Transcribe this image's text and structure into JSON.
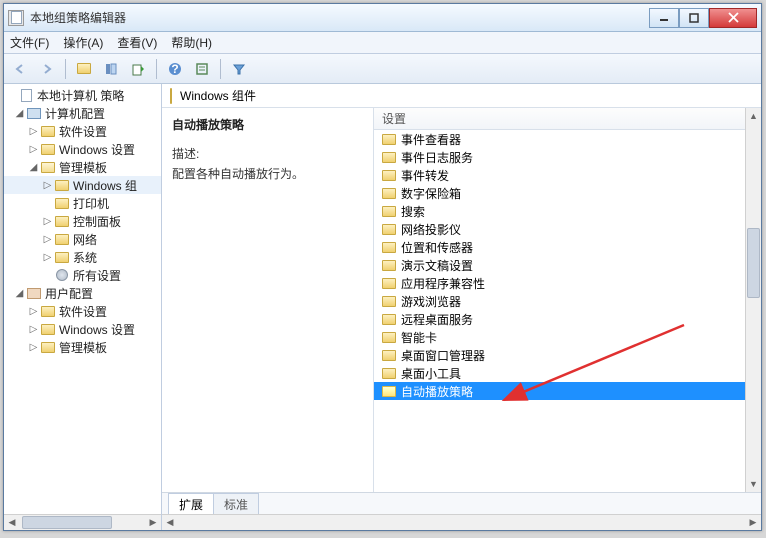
{
  "window": {
    "title": "本地组策略编辑器"
  },
  "menu": {
    "file": "文件(F)",
    "action": "操作(A)",
    "view": "查看(V)",
    "help": "帮助(H)"
  },
  "tree": {
    "root": "本地计算机 策略",
    "computer": "计算机配置",
    "c_software": "软件设置",
    "c_windows": "Windows 设置",
    "c_admin": "管理模板",
    "c_admin_win": "Windows 组",
    "c_admin_printer": "打印机",
    "c_admin_control": "控制面板",
    "c_admin_network": "网络",
    "c_admin_system": "系统",
    "c_admin_all": "所有设置",
    "user": "用户配置",
    "u_software": "软件设置",
    "u_windows": "Windows 设置",
    "u_admin": "管理模板"
  },
  "content": {
    "header": "Windows 组件",
    "title": "自动播放策略",
    "desc_label": "描述:",
    "desc_text": "配置各种自动播放行为。",
    "column": "设置"
  },
  "items": [
    "事件查看器",
    "事件日志服务",
    "事件转发",
    "数字保险箱",
    "搜索",
    "网络投影仪",
    "位置和传感器",
    "演示文稿设置",
    "应用程序兼容性",
    "游戏浏览器",
    "远程桌面服务",
    "智能卡",
    "桌面窗口管理器",
    "桌面小工具",
    "自动播放策略"
  ],
  "selected_index": 14,
  "tabs": {
    "extended": "扩展",
    "standard": "标准"
  }
}
